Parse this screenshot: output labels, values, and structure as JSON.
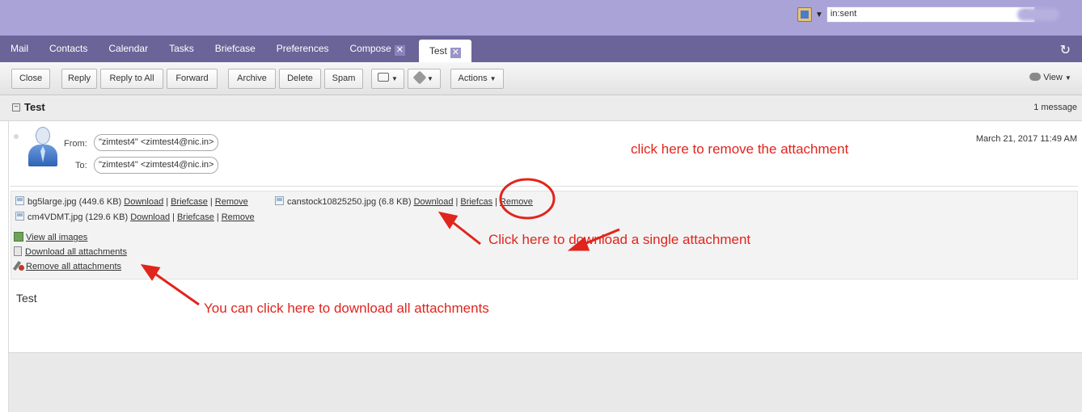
{
  "search": {
    "value": "in:sent",
    "type_icon": "mail-search-icon",
    "glass_icon": "search-icon"
  },
  "app_tabs": [
    {
      "label": "Mail"
    },
    {
      "label": "Contacts"
    },
    {
      "label": "Calendar"
    },
    {
      "label": "Tasks"
    },
    {
      "label": "Briefcase"
    },
    {
      "label": "Preferences"
    },
    {
      "label": "Compose"
    },
    {
      "label": "Test"
    }
  ],
  "toolbar": {
    "close": "Close",
    "reply": "Reply",
    "reply_all": "Reply to All",
    "forward": "Forward",
    "archive": "Archive",
    "delete": "Delete",
    "spam": "Spam",
    "actions": "Actions",
    "view": "View"
  },
  "conversation": {
    "title": "Test",
    "count": "1 message"
  },
  "message": {
    "from_label": "From:",
    "from": "\"zimtest4\" <zimtest4@nic.in>",
    "to_label": "To:",
    "to": "\"zimtest4\" <zimtest4@nic.in>",
    "date": "March 21, 2017 11:49 AM",
    "body": "Test"
  },
  "attachments": [
    {
      "name": "bg5large.jpg",
      "size": "(449.6 KB)"
    },
    {
      "name": "canstock10825250.jpg",
      "size": "(6.8 KB)"
    },
    {
      "name": "cm4VDMT.jpg",
      "size": "(129.6 KB)"
    }
  ],
  "attachment_links": {
    "download": "Download",
    "briefcase": "Briefcase",
    "remove": "Remove",
    "briefcase_trunc": "Briefcas"
  },
  "attachment_actions": {
    "view_all": "View all images",
    "download_all": "Download all attachments",
    "remove_all": "Remove all attachments"
  },
  "annotations": {
    "remove": "click here to remove the attachment",
    "download_single": "Click here to download a single attachment",
    "download_all": "You can click here to download all attachments",
    "color": "#e0251d"
  }
}
